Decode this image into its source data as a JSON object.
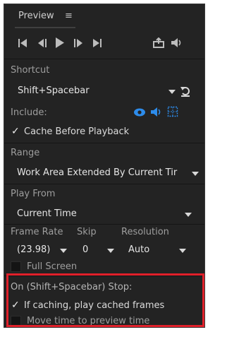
{
  "panel": {
    "title": "Preview",
    "menu_icon": "hamburger-menu-icon"
  },
  "transport": {
    "buttons": [
      "skip-to-start-icon",
      "step-back-icon",
      "play-icon",
      "step-forward-icon",
      "skip-to-end-icon"
    ],
    "right_buttons": [
      "export-frame-icon",
      "audio-icon"
    ],
    "accent": "#bcbcbc"
  },
  "shortcut": {
    "label": "Shortcut",
    "value": "Shift+Spacebar",
    "reset_icon": "reset-icon"
  },
  "include": {
    "label": "Include:",
    "icons": [
      "video-eye-icon",
      "audio-speaker-icon",
      "overlay-grid-icon"
    ],
    "icon_color": "#2d8ceb"
  },
  "cache": {
    "label": "Cache Before Playback",
    "checked": true
  },
  "range": {
    "label": "Range",
    "value": "Work Area Extended By Current Tir"
  },
  "play_from": {
    "label": "Play From",
    "value": "Current Time"
  },
  "frame_rate": {
    "label": "Frame Rate",
    "value": "(23.98)"
  },
  "skip": {
    "label": "Skip",
    "value": "0"
  },
  "resolution": {
    "label": "Resolution",
    "value": "Auto"
  },
  "full_screen": {
    "label": "Full Screen",
    "checked": false
  },
  "stop": {
    "label": "On (Shift+Spacebar) Stop:",
    "options": [
      {
        "label": "If caching, play cached frames",
        "checked": true
      },
      {
        "label": "Move time to preview time",
        "checked": false
      }
    ],
    "highlight_color": "#e0202a"
  }
}
